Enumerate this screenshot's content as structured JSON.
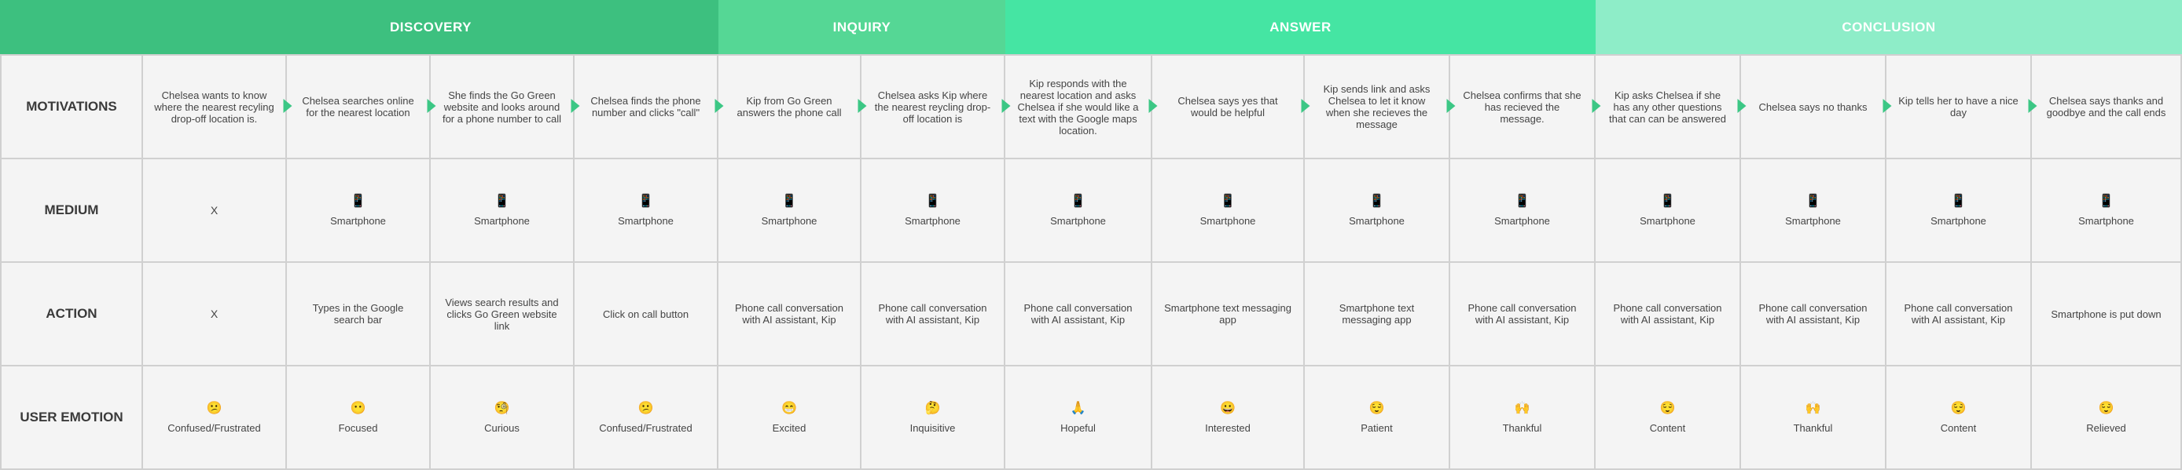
{
  "phases": [
    {
      "label": "DISCOVERY",
      "color": "#3dc07f"
    },
    {
      "label": "INQUIRY",
      "color": "#55d795"
    },
    {
      "label": "ANSWER",
      "color": "#45e5a3"
    },
    {
      "label": "CONCLUSION",
      "color": "#8eedc8"
    }
  ],
  "row_labels": [
    "MOTIVATIONS",
    "MEDIUM",
    "ACTION",
    "USER EMOTION"
  ],
  "motivations": [
    "Chelsea wants to know where the nearest recyling drop-off location is.",
    "Chelsea searches online for the nearest location",
    "She finds the Go Green website and looks around for a phone number to call",
    "Chelsea finds the phone number and clicks \"call\"",
    "Kip from Go Green answers the phone call",
    "Chelsea asks Kip where the nearest reycling drop-off location is",
    "Kip responds with the nearest location and asks Chelsea if she would like a text with the Google maps location.",
    "Chelsea says yes that would be helpful",
    "Kip sends link and asks Chelsea to let it know when she recieves the message",
    "Chelsea confirms that she has recieved the message.",
    "Kip asks Chelsea if she has any other questions that can can be answered",
    "Chelsea says no thanks",
    "Kip tells her to have a nice day",
    "Chelsea says thanks and goodbye and the call ends"
  ],
  "medium": [
    {
      "icon": "",
      "label": "X"
    },
    {
      "icon": "📱",
      "label": "Smartphone"
    },
    {
      "icon": "📱",
      "label": "Smartphone"
    },
    {
      "icon": "📱",
      "label": "Smartphone"
    },
    {
      "icon": "📱",
      "label": "Smartphone"
    },
    {
      "icon": "📱",
      "label": "Smartphone"
    },
    {
      "icon": "📱",
      "label": "Smartphone"
    },
    {
      "icon": "📱",
      "label": "Smartphone"
    },
    {
      "icon": "📱",
      "label": "Smartphone"
    },
    {
      "icon": "📱",
      "label": "Smartphone"
    },
    {
      "icon": "📱",
      "label": "Smartphone"
    },
    {
      "icon": "📱",
      "label": "Smartphone"
    },
    {
      "icon": "📱",
      "label": "Smartphone"
    },
    {
      "icon": "📱",
      "label": "Smartphone"
    }
  ],
  "actions": [
    "X",
    "Types in the Google search bar",
    "Views search results and clicks Go Green website link",
    "Click on call button",
    "Phone call conversation with AI assistant, Kip",
    "Phone call conversation with AI assistant, Kip",
    "Phone call conversation with AI assistant, Kip",
    "Smartphone text messaging app",
    "Smartphone text messaging app",
    "Phone call conversation with AI assistant, Kip",
    "Phone call conversation with AI assistant, Kip",
    "Phone call conversation with AI assistant, Kip",
    "Phone call conversation with AI assistant, Kip",
    "Smartphone is put down"
  ],
  "emotions": [
    {
      "icon": "😕",
      "label": "Confused/Frustrated"
    },
    {
      "icon": "😶",
      "label": "Focused"
    },
    {
      "icon": "🧐",
      "label": "Curious"
    },
    {
      "icon": "😕",
      "label": "Confused/Frustrated"
    },
    {
      "icon": "😁",
      "label": "Excited"
    },
    {
      "icon": "🤔",
      "label": "Inquisitive"
    },
    {
      "icon": "🙏",
      "label": "Hopeful"
    },
    {
      "icon": "😀",
      "label": "Interested"
    },
    {
      "icon": "😌",
      "label": "Patient"
    },
    {
      "icon": "🙌",
      "label": "Thankful"
    },
    {
      "icon": "😌",
      "label": "Content"
    },
    {
      "icon": "🙌",
      "label": "Thankful"
    },
    {
      "icon": "😌",
      "label": "Content"
    },
    {
      "icon": "😌",
      "label": "Relieved"
    }
  ]
}
